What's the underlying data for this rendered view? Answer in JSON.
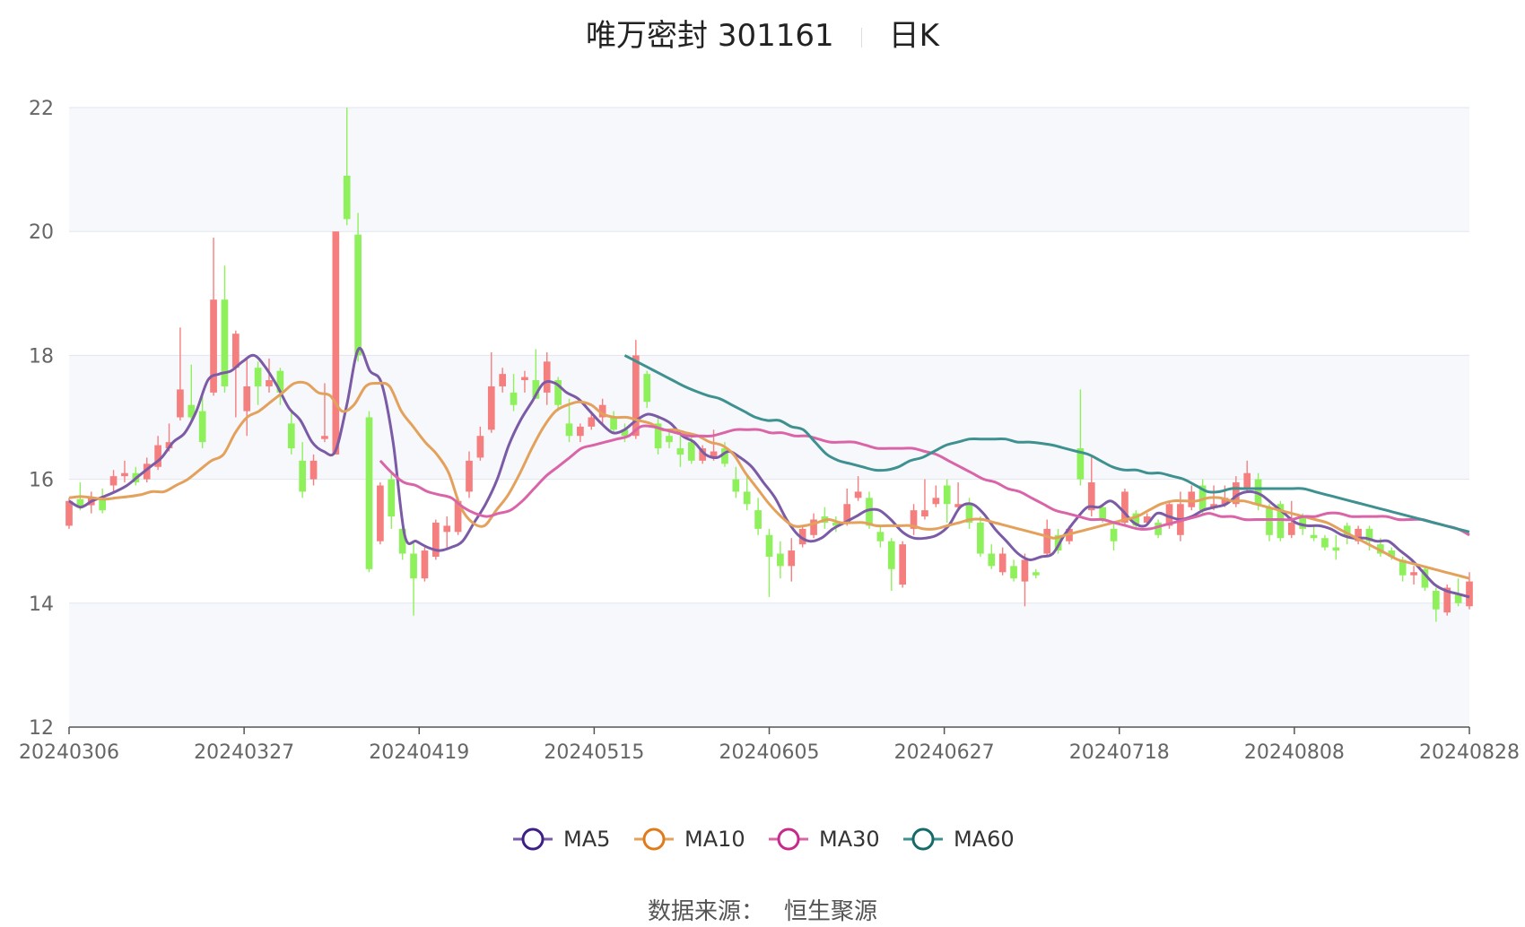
{
  "header": {
    "title_name": "唯万密封 301161",
    "title_period": "日K"
  },
  "source": {
    "label": "数据来源：",
    "value": "恒生聚源"
  },
  "chart_data": {
    "type": "candlestick",
    "x_tick_labels": [
      "20240306",
      "20240327",
      "20240419",
      "20240515",
      "20240605",
      "20240627",
      "20240718",
      "20240808",
      "20240828"
    ],
    "y_ticks": [
      12,
      14,
      16,
      18,
      20,
      22
    ],
    "ylim": [
      12,
      22
    ],
    "colors": {
      "up": "#f57e7e",
      "down": "#8ef05a",
      "grid": "#e1e5ef",
      "band": "#f6f8fc"
    },
    "legend": [
      {
        "name": "MA5",
        "color": "#7b5aa6",
        "marker": "#3d1f86"
      },
      {
        "name": "MA10",
        "color": "#e3a15c",
        "marker": "#e07b1b"
      },
      {
        "name": "MA30",
        "color": "#d964a8",
        "marker": "#c72a8a"
      },
      {
        "name": "MA60",
        "color": "#3e9190",
        "marker": "#166b6a"
      }
    ],
    "candles": [
      [
        15.25,
        15.65,
        15.7,
        15.2
      ],
      [
        15.68,
        15.55,
        15.95,
        15.5
      ],
      [
        15.58,
        15.7,
        15.8,
        15.45
      ],
      [
        15.68,
        15.5,
        15.85,
        15.45
      ],
      [
        15.9,
        16.05,
        16.15,
        15.8
      ],
      [
        16.05,
        16.1,
        16.3,
        15.95
      ],
      [
        16.1,
        15.95,
        16.2,
        15.9
      ],
      [
        16.0,
        16.25,
        16.35,
        15.95
      ],
      [
        16.2,
        16.55,
        16.7,
        16.15
      ],
      [
        16.5,
        16.6,
        16.9,
        16.45
      ],
      [
        17.0,
        17.45,
        18.45,
        16.95
      ],
      [
        17.2,
        17.0,
        17.85,
        16.9
      ],
      [
        17.1,
        16.6,
        17.4,
        16.5
      ],
      [
        17.4,
        18.9,
        19.9,
        17.35
      ],
      [
        18.9,
        17.5,
        19.45,
        17.4
      ],
      [
        17.8,
        18.35,
        18.4,
        17.0
      ],
      [
        17.1,
        17.5,
        17.95,
        16.7
      ],
      [
        17.8,
        17.5,
        17.9,
        17.2
      ],
      [
        17.5,
        17.6,
        17.95,
        17.4
      ],
      [
        17.75,
        17.4,
        17.8,
        17.2
      ],
      [
        16.9,
        16.5,
        17.1,
        16.4
      ],
      [
        16.3,
        15.8,
        16.6,
        15.7
      ],
      [
        16.0,
        16.3,
        16.4,
        15.9
      ],
      [
        16.65,
        16.7,
        17.55,
        16.6
      ],
      [
        16.4,
        20.0,
        20.0,
        16.4
      ],
      [
        20.9,
        20.2,
        22.0,
        20.1
      ],
      [
        19.95,
        18.0,
        20.3,
        17.9
      ],
      [
        17.0,
        14.55,
        17.1,
        14.5
      ],
      [
        15.0,
        15.9,
        15.95,
        14.95
      ],
      [
        16.0,
        15.4,
        16.1,
        15.2
      ],
      [
        15.2,
        14.8,
        15.3,
        14.7
      ],
      [
        14.8,
        14.4,
        15.0,
        13.8
      ],
      [
        14.4,
        14.85,
        14.9,
        14.35
      ],
      [
        14.75,
        15.3,
        15.35,
        14.7
      ],
      [
        15.15,
        15.25,
        15.4,
        14.9
      ],
      [
        15.15,
        15.65,
        15.7,
        15.1
      ],
      [
        15.8,
        16.3,
        16.45,
        15.7
      ],
      [
        16.35,
        16.7,
        16.85,
        16.3
      ],
      [
        16.8,
        17.5,
        18.05,
        16.75
      ],
      [
        17.5,
        17.7,
        17.8,
        17.4
      ],
      [
        17.4,
        17.2,
        17.7,
        17.1
      ],
      [
        17.6,
        17.65,
        17.75,
        17.4
      ],
      [
        17.6,
        17.3,
        18.1,
        17.3
      ],
      [
        17.4,
        17.9,
        18.05,
        17.2
      ],
      [
        17.6,
        17.2,
        17.65,
        17.1
      ],
      [
        16.9,
        16.7,
        17.3,
        16.6
      ],
      [
        16.7,
        16.85,
        16.9,
        16.6
      ],
      [
        16.85,
        17.0,
        17.1,
        16.8
      ],
      [
        17.0,
        17.2,
        17.3,
        16.9
      ],
      [
        17.0,
        16.8,
        17.1,
        16.75
      ],
      [
        16.8,
        16.7,
        16.9,
        16.6
      ],
      [
        16.7,
        18.0,
        18.25,
        16.65
      ],
      [
        17.7,
        17.25,
        17.75,
        17.15
      ],
      [
        16.9,
        16.5,
        17.0,
        16.4
      ],
      [
        16.7,
        16.6,
        16.8,
        16.5
      ],
      [
        16.5,
        16.4,
        16.7,
        16.2
      ],
      [
        16.6,
        16.3,
        16.75,
        16.25
      ],
      [
        16.3,
        16.5,
        16.55,
        16.25
      ],
      [
        16.35,
        16.45,
        16.8,
        16.3
      ],
      [
        16.5,
        16.25,
        16.6,
        16.2
      ],
      [
        16.0,
        15.8,
        16.2,
        15.7
      ],
      [
        15.8,
        15.6,
        16.05,
        15.5
      ],
      [
        15.5,
        15.2,
        15.7,
        15.1
      ],
      [
        15.1,
        14.75,
        15.2,
        14.1
      ],
      [
        14.8,
        14.6,
        15.0,
        14.4
      ],
      [
        14.6,
        14.85,
        15.05,
        14.35
      ],
      [
        14.95,
        15.2,
        15.25,
        14.9
      ],
      [
        15.1,
        15.35,
        15.45,
        15.05
      ],
      [
        15.4,
        15.3,
        15.55,
        15.2
      ],
      [
        15.3,
        15.25,
        15.4,
        15.15
      ],
      [
        15.3,
        15.6,
        15.85,
        15.25
      ],
      [
        15.7,
        15.8,
        16.05,
        15.65
      ],
      [
        15.7,
        15.25,
        15.8,
        15.2
      ],
      [
        15.15,
        15.0,
        15.25,
        14.9
      ],
      [
        15.0,
        14.55,
        15.05,
        14.2
      ],
      [
        14.3,
        14.95,
        15.0,
        14.25
      ],
      [
        15.2,
        15.5,
        15.6,
        15.1
      ],
      [
        15.4,
        15.5,
        16.0,
        15.35
      ],
      [
        15.6,
        15.7,
        15.9,
        15.55
      ],
      [
        15.9,
        15.6,
        16.0,
        15.3
      ],
      [
        15.55,
        15.6,
        15.95,
        15.5
      ],
      [
        15.6,
        15.3,
        15.7,
        15.2
      ],
      [
        15.3,
        14.8,
        15.4,
        14.75
      ],
      [
        14.8,
        14.6,
        14.95,
        14.55
      ],
      [
        14.5,
        14.8,
        14.9,
        14.45
      ],
      [
        14.6,
        14.4,
        14.7,
        14.35
      ],
      [
        14.35,
        14.7,
        14.8,
        13.95
      ],
      [
        14.5,
        14.45,
        14.55,
        14.4
      ],
      [
        14.8,
        15.2,
        15.35,
        14.75
      ],
      [
        15.1,
        14.85,
        15.2,
        14.8
      ],
      [
        15.0,
        15.2,
        15.25,
        14.95
      ],
      [
        16.5,
        16.0,
        17.45,
        15.9
      ],
      [
        15.5,
        15.95,
        16.4,
        15.4
      ],
      [
        15.55,
        15.35,
        15.6,
        15.3
      ],
      [
        15.2,
        15.0,
        15.3,
        14.85
      ],
      [
        15.3,
        15.8,
        15.85,
        15.25
      ],
      [
        15.45,
        15.25,
        15.5,
        15.2
      ],
      [
        15.3,
        15.4,
        15.45,
        15.25
      ],
      [
        15.3,
        15.1,
        15.35,
        15.05
      ],
      [
        15.25,
        15.6,
        15.65,
        15.2
      ],
      [
        15.1,
        15.6,
        15.8,
        15.0
      ],
      [
        15.55,
        15.8,
        15.9,
        15.5
      ],
      [
        15.9,
        15.5,
        16.0,
        15.45
      ],
      [
        15.55,
        15.6,
        15.9,
        15.5
      ],
      [
        15.6,
        15.7,
        15.9,
        15.55
      ],
      [
        15.6,
        15.95,
        16.05,
        15.55
      ],
      [
        15.85,
        16.1,
        16.3,
        15.8
      ],
      [
        16.0,
        15.6,
        16.1,
        15.5
      ],
      [
        15.55,
        15.1,
        15.6,
        15.0
      ],
      [
        15.6,
        15.05,
        15.65,
        15.0
      ],
      [
        15.1,
        15.3,
        15.65,
        15.05
      ],
      [
        15.4,
        15.2,
        15.45,
        15.1
      ],
      [
        15.1,
        15.05,
        15.25,
        15.0
      ],
      [
        15.05,
        14.9,
        15.1,
        14.85
      ],
      [
        14.9,
        14.85,
        15.1,
        14.7
      ],
      [
        15.25,
        15.1,
        15.3,
        14.95
      ],
      [
        15.0,
        15.2,
        15.25,
        14.95
      ],
      [
        15.2,
        15.0,
        15.25,
        14.85
      ],
      [
        14.95,
        14.8,
        15.05,
        14.75
      ],
      [
        14.85,
        14.75,
        14.9,
        14.7
      ],
      [
        14.7,
        14.45,
        14.75,
        14.35
      ],
      [
        14.45,
        14.5,
        14.6,
        14.3
      ],
      [
        14.55,
        14.25,
        14.6,
        14.2
      ],
      [
        14.2,
        13.9,
        14.25,
        13.7
      ],
      [
        13.85,
        14.25,
        14.3,
        13.8
      ],
      [
        14.15,
        14.0,
        14.4,
        13.95
      ],
      [
        13.95,
        14.35,
        14.5,
        13.9
      ]
    ],
    "ma": {
      "MA5": [
        15.65,
        15.55,
        15.65,
        15.72,
        15.8,
        15.9,
        16.05,
        16.2,
        16.35,
        16.6,
        16.75,
        17.1,
        17.6,
        17.7,
        17.75,
        17.9,
        18.0,
        17.8,
        17.5,
        17.15,
        16.95,
        16.6,
        16.45,
        16.45,
        17.2,
        18.1,
        17.75,
        17.55,
        16.6,
        15.1,
        15.0,
        14.9,
        14.85,
        14.9,
        15.0,
        15.3,
        15.6,
        16.0,
        16.55,
        16.95,
        17.25,
        17.55,
        17.55,
        17.4,
        17.3,
        17.1,
        16.9,
        16.75,
        16.8,
        16.95,
        17.05,
        17.0,
        16.9,
        16.7,
        16.6,
        16.4,
        16.35,
        16.45,
        16.35,
        16.2,
        15.95,
        15.7,
        15.35,
        15.1,
        15.0,
        15.05,
        15.2,
        15.3,
        15.4,
        15.5,
        15.5,
        15.35,
        15.15,
        15.05,
        15.05,
        15.1,
        15.25,
        15.55,
        15.6,
        15.45,
        15.2,
        15.0,
        14.8,
        14.7,
        14.75,
        14.8,
        15.1,
        15.35,
        15.55,
        15.55,
        15.65,
        15.5,
        15.3,
        15.25,
        15.45,
        15.4,
        15.35,
        15.4,
        15.5,
        15.55,
        15.6,
        15.75,
        15.8,
        15.75,
        15.6,
        15.45,
        15.3,
        15.25,
        15.25,
        15.2,
        15.1,
        15.05,
        15.05,
        15.0,
        15.0,
        14.85,
        14.7,
        14.5,
        14.3,
        14.2,
        14.15,
        14.1
      ],
      "MA10": [
        15.7,
        15.72,
        15.7,
        15.68,
        15.7,
        15.72,
        15.75,
        15.8,
        15.8,
        15.9,
        16.0,
        16.15,
        16.3,
        16.4,
        16.75,
        17.0,
        17.1,
        17.25,
        17.4,
        17.55,
        17.55,
        17.4,
        17.35,
        17.1,
        17.2,
        17.5,
        17.55,
        17.5,
        17.1,
        16.85,
        16.6,
        16.4,
        16.1,
        15.55,
        15.3,
        15.25,
        15.5,
        15.75,
        16.1,
        16.5,
        16.85,
        17.1,
        17.2,
        17.25,
        17.2,
        17.05,
        17.0,
        17.0,
        16.95,
        16.9,
        16.8,
        16.8,
        16.75,
        16.7,
        16.6,
        16.55,
        16.4,
        16.1,
        15.85,
        15.6,
        15.4,
        15.25,
        15.25,
        15.3,
        15.35,
        15.3,
        15.3,
        15.3,
        15.25,
        15.25,
        15.25,
        15.25,
        15.2,
        15.2,
        15.25,
        15.3,
        15.35,
        15.35,
        15.3,
        15.25,
        15.2,
        15.15,
        15.1,
        15.05,
        15.1,
        15.15,
        15.2,
        15.25,
        15.3,
        15.35,
        15.4,
        15.5,
        15.6,
        15.65,
        15.65,
        15.65,
        15.7,
        15.7,
        15.65,
        15.65,
        15.6,
        15.55,
        15.5,
        15.45,
        15.4,
        15.35,
        15.3,
        15.2,
        15.1,
        15.0,
        14.9,
        14.8,
        14.7,
        14.65,
        14.6,
        14.55,
        14.5,
        14.45,
        14.4
      ],
      "MA30": [
        16.3,
        16.1,
        15.95,
        15.9,
        15.8,
        15.75,
        15.7,
        15.55,
        15.45,
        15.4,
        15.45,
        15.5,
        15.65,
        15.85,
        16.05,
        16.2,
        16.35,
        16.5,
        16.55,
        16.6,
        16.65,
        16.7,
        16.85,
        16.85,
        16.8,
        16.75,
        16.7,
        16.7,
        16.7,
        16.75,
        16.8,
        16.8,
        16.8,
        16.75,
        16.75,
        16.7,
        16.7,
        16.65,
        16.6,
        16.6,
        16.6,
        16.55,
        16.5,
        16.5,
        16.5,
        16.5,
        16.45,
        16.4,
        16.3,
        16.2,
        16.1,
        16.0,
        15.95,
        15.85,
        15.8,
        15.7,
        15.6,
        15.5,
        15.45,
        15.4,
        15.35,
        15.35,
        15.3,
        15.25,
        15.2,
        15.2,
        15.25,
        15.3,
        15.35,
        15.4,
        15.45,
        15.4,
        15.4,
        15.35,
        15.35,
        15.35,
        15.35,
        15.35,
        15.4,
        15.4,
        15.45,
        15.45,
        15.4,
        15.4,
        15.4,
        15.4,
        15.35,
        15.35,
        15.35,
        15.3,
        15.25,
        15.2,
        15.1
      ],
      "MA60": [
        18.0,
        17.9,
        17.8,
        17.7,
        17.6,
        17.5,
        17.42,
        17.35,
        17.3,
        17.2,
        17.1,
        17.0,
        16.95,
        16.95,
        16.85,
        16.8,
        16.6,
        16.4,
        16.3,
        16.25,
        16.2,
        16.15,
        16.15,
        16.2,
        16.3,
        16.35,
        16.45,
        16.55,
        16.6,
        16.65,
        16.65,
        16.65,
        16.65,
        16.6,
        16.6,
        16.58,
        16.55,
        16.5,
        16.45,
        16.4,
        16.3,
        16.2,
        16.15,
        16.15,
        16.1,
        16.1,
        16.05,
        16.0,
        15.9,
        15.8,
        15.8,
        15.85,
        15.85,
        15.85,
        15.85,
        15.85,
        15.85,
        15.85,
        15.8,
        15.75,
        15.7,
        15.65,
        15.6,
        15.55,
        15.5,
        15.45,
        15.4,
        15.35,
        15.3,
        15.25,
        15.2,
        15.15
      ]
    },
    "ma_offsets": {
      "MA5": 0,
      "MA10": 0,
      "MA30": 28,
      "MA60": 50
    }
  }
}
